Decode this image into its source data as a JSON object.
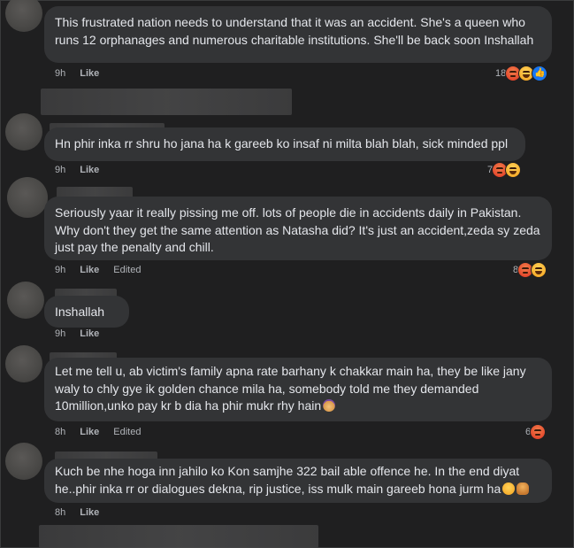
{
  "comments": [
    {
      "text": "This frustrated nation needs to understand that it was an accident. She's a queen who runs 12 orphanages and numerous charitable institutions. She'll be back soon Inshallah",
      "time": "9h",
      "like": "Like",
      "edited": "",
      "reaction_count": "18",
      "reactions": [
        "angry-icon",
        "haha-icon",
        "like-icon"
      ]
    },
    {
      "text": "Hn phir inka rr shru ho jana ha k gareeb ko insaf ni milta blah blah, sick minded ppl",
      "time": "9h",
      "like": "Like",
      "edited": "",
      "reaction_count": "7",
      "reactions": [
        "angry-icon",
        "haha-icon"
      ]
    },
    {
      "text": "Seriously yaar it really pissing me off. lots of people die in accidents daily in Pakistan. Why don't they get the same attention as Natasha did? It's just an accident,zeda sy zeda just pay the penalty and chill.",
      "time": "9h",
      "like": "Like",
      "edited": "Edited",
      "reaction_count": "8",
      "reactions": [
        "angry-icon",
        "haha-icon"
      ]
    },
    {
      "text": "Inshallah",
      "time": "9h",
      "like": "Like",
      "edited": "",
      "reaction_count": "",
      "reactions": []
    },
    {
      "text": "Let me tell u, ab victim's family apna rate barhany k chakkar main ha, they be like jany waly to chly gye ik golden chance mila ha, somebody told me they demanded 10million,unko pay kr b dia ha phir mukr rhy hain",
      "time": "8h",
      "like": "Like",
      "edited": "Edited",
      "reaction_count": "6",
      "reactions": [
        "angry-icon"
      ]
    },
    {
      "text": "Kuch be nhe hoga inn jahilo ko Kon samjhe 322 bail able offence he. In the end diyat he..phir inka rr or dialogues dekna, rip justice, iss mulk main gareeb hona jurm ha",
      "time": "8h",
      "like": "Like",
      "edited": "",
      "reaction_count": "",
      "reactions": []
    }
  ],
  "colors": {
    "background": "#1f1f20",
    "bubble": "#333436",
    "text": "#e4e6eb",
    "meta": "#b0b3b8"
  }
}
